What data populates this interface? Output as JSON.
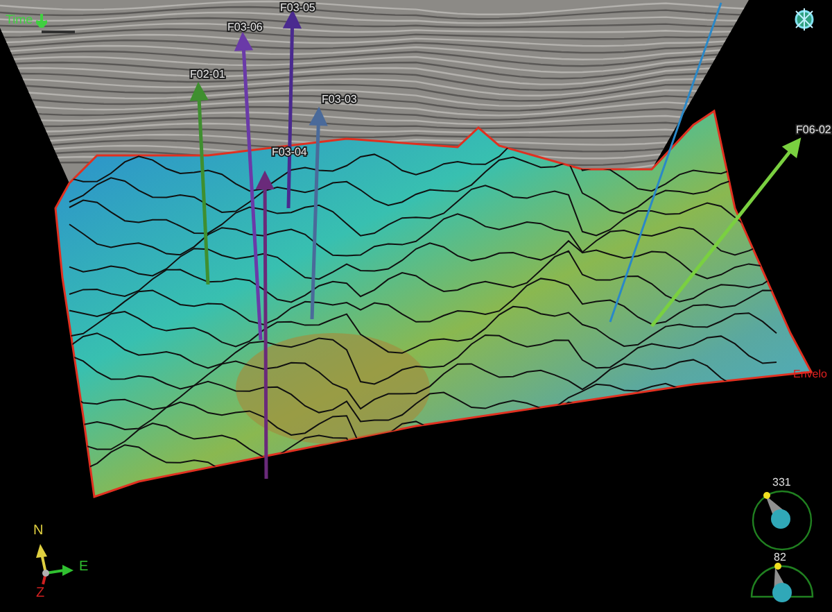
{
  "toolbar": {
    "domain_label": "Time"
  },
  "wells": [
    {
      "name": "F02-01",
      "color": "#3f8f2f"
    },
    {
      "name": "F03-06",
      "color": "#6a3aa8"
    },
    {
      "name": "F03-05",
      "color": "#4a2a8f"
    },
    {
      "name": "F03-03",
      "color": "#4a6a9a"
    },
    {
      "name": "F03-04",
      "color": "#6a2a7a"
    },
    {
      "name": "F06-02",
      "color": "#7ad040"
    }
  ],
  "horizon": {
    "label": "Envelo"
  },
  "orientation_axes": {
    "north": "N",
    "east": "E",
    "depth": "Z"
  },
  "view_angles": {
    "azimuth": "331",
    "dip": "82"
  }
}
